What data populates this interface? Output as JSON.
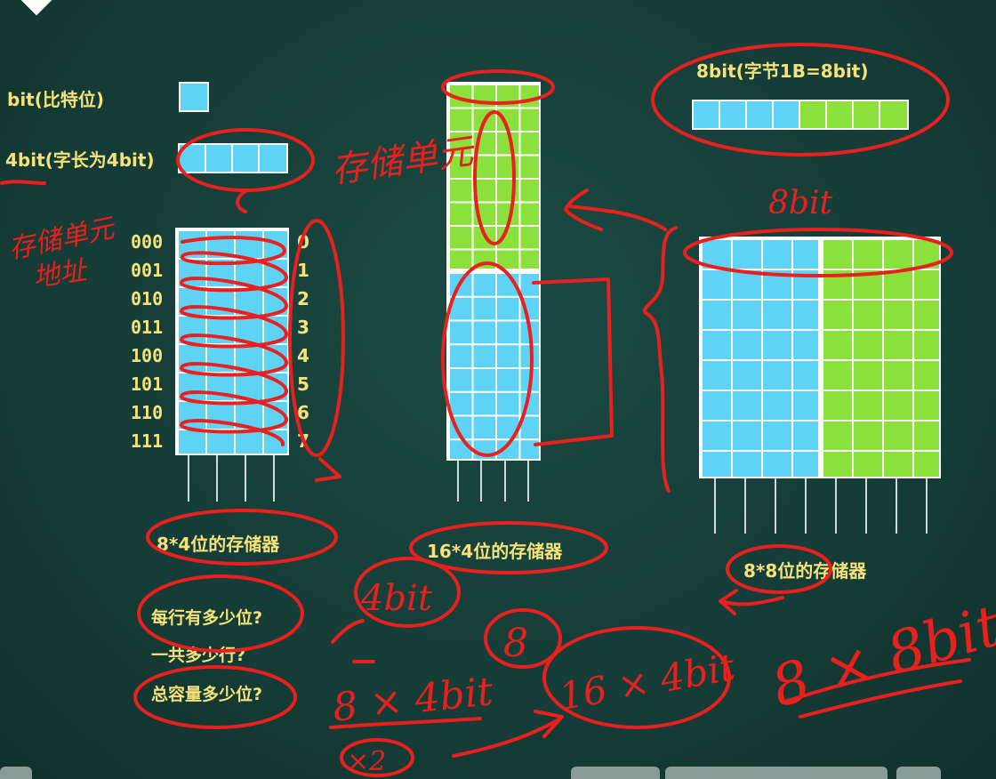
{
  "labels": {
    "bit": "bit(比特位)",
    "bit4": "4bit(字长为4bit)",
    "bit8": "8bit(字节1B=8bit)",
    "mem8x4": "8*4位的存储器",
    "mem16x4": "16*4位的存储器",
    "mem8x8": "8*8位的存储器",
    "q1": "每行有多少位?",
    "q2": "一共多少行?",
    "q3": "总容量多少位?"
  },
  "addresses": [
    "000",
    "001",
    "010",
    "011",
    "100",
    "101",
    "110",
    "111"
  ],
  "indices": [
    "0",
    "1",
    "2",
    "3",
    "4",
    "5",
    "6",
    "7"
  ],
  "handwriting": {
    "storage_unit_top": "存储单元",
    "storage_unit_addr_1": "存储单元",
    "storage_unit_addr_2": "地址",
    "bit8_top": "8bit",
    "bits4": "4bit",
    "rows8": "8",
    "eq1": "8 × 4bit",
    "times2": "×2",
    "eq2": "16 × 4bit",
    "eq3": "8 × 8bit"
  },
  "colors": {
    "board": "#153f39",
    "blue": "#5fd3f5",
    "green": "#8be03c",
    "chalk": "#f5e27a",
    "ink": "#e8201e"
  }
}
